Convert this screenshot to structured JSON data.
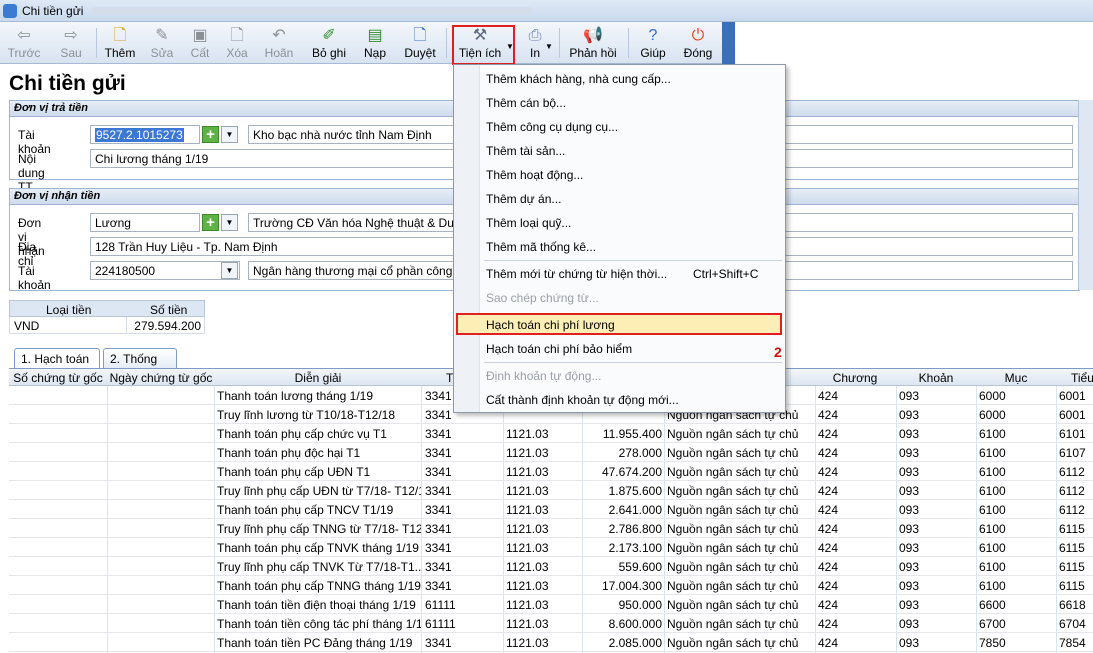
{
  "window": {
    "title": "Chi tiền gửi"
  },
  "toolbar": {
    "back": "Trước",
    "next": "Sau",
    "add": "Thêm",
    "edit": "Sửa",
    "save": "Cất",
    "delete": "Xóa",
    "undo": "Hoãn",
    "unpost": "Bỏ ghi",
    "submit": "Nạp",
    "approve": "Duyệt",
    "utilities": "Tiện ích",
    "print": "In",
    "feedback": "Phản hồi",
    "help": "Giúp",
    "close": "Đóng"
  },
  "annotations": {
    "step1": "1",
    "step2": "2"
  },
  "page": {
    "title": "Chi tiền gửi"
  },
  "payer": {
    "header": "Đơn vị trả tiền",
    "account_label": "Tài khoản",
    "account_value": "9527.2.1015273",
    "account_name": "Kho bạc nhà nước tỉnh Nam Định",
    "content_label": "Nội dung TT",
    "content_value": "Chi lương tháng 1/19"
  },
  "payee": {
    "header": "Đơn vị nhận tiền",
    "unit_label": "Đơn vị nhận",
    "unit_value": "Lương",
    "unit_name": "Trường CĐ Văn hóa Nghệ thuật & Du lịch",
    "address_label": "Địa chỉ",
    "address_value": "128 Trần Huy Liệu - Tp. Nam Định",
    "account_label": "Tài khoản",
    "account_value": "224180500",
    "bank_name": "Ngân hàng thương mại cổ phần công thương"
  },
  "money": {
    "type_header": "Loại tiền",
    "amount_header": "Số tiền",
    "type": "VND",
    "amount": "279.594.200"
  },
  "tabs": {
    "t1": "1. Hạch toán",
    "t2": "2. Thống kê"
  },
  "grid": {
    "headers": [
      "Số chứng từ gốc",
      "Ngày chứng từ gốc",
      "Diễn giải",
      "T",
      "Chương",
      "Khoản",
      "Mục",
      "Tiểu"
    ],
    "rows": [
      {
        "desc": "Thanh toán lương tháng 1/19",
        "tk": "3341",
        "tkd": "",
        "amt": "",
        "src": "",
        "ch": "424",
        "kh": "093",
        "muc": "6000",
        "tieu": "6001"
      },
      {
        "desc": "Truy lĩnh lương từ T10/18-T12/18",
        "tk": "3341",
        "tkd": "",
        "amt": "",
        "src": "Nguồn ngân sách tự chủ",
        "ch": "424",
        "kh": "093",
        "muc": "6000",
        "tieu": "6001"
      },
      {
        "desc": "Thanh toán phụ cấp chức vụ T1",
        "tk": "3341",
        "tkd": "1121.03",
        "amt": "11.955.400",
        "src": "Nguồn ngân sách tự chủ",
        "ch": "424",
        "kh": "093",
        "muc": "6100",
        "tieu": "6101"
      },
      {
        "desc": "Thanh toán phụ độc hại T1",
        "tk": "3341",
        "tkd": "1121.03",
        "amt": "278.000",
        "src": "Nguồn ngân sách tự chủ",
        "ch": "424",
        "kh": "093",
        "muc": "6100",
        "tieu": "6107"
      },
      {
        "desc": "Thanh toán phụ cấp UĐN T1",
        "tk": "3341",
        "tkd": "1121.03",
        "amt": "47.674.200",
        "src": "Nguồn ngân sách tự chủ",
        "ch": "424",
        "kh": "093",
        "muc": "6100",
        "tieu": "6112"
      },
      {
        "desc": "Truy lĩnh phụ cấp UĐN từ T7/18- T12/18",
        "tk": "3341",
        "tkd": "1121.03",
        "amt": "1.875.600",
        "src": "Nguồn ngân sách tự chủ",
        "ch": "424",
        "kh": "093",
        "muc": "6100",
        "tieu": "6112"
      },
      {
        "desc": "Thanh toán phụ cấp TNCV T1/19",
        "tk": "3341",
        "tkd": "1121.03",
        "amt": "2.641.000",
        "src": "Nguồn ngân sách tự chủ",
        "ch": "424",
        "kh": "093",
        "muc": "6100",
        "tieu": "6112"
      },
      {
        "desc": "Truy lĩnh phụ cấp TNNG từ T7/18- T12...",
        "tk": "3341",
        "tkd": "1121.03",
        "amt": "2.786.800",
        "src": "Nguồn ngân sách tự chủ",
        "ch": "424",
        "kh": "093",
        "muc": "6100",
        "tieu": "6115"
      },
      {
        "desc": "Thanh toán phụ cấp TNVK tháng 1/19",
        "tk": "3341",
        "tkd": "1121.03",
        "amt": "2.173.100",
        "src": "Nguồn ngân sách tự chủ",
        "ch": "424",
        "kh": "093",
        "muc": "6100",
        "tieu": "6115"
      },
      {
        "desc": "Truy lĩnh  phụ cấp TNVK Từ T7/18-T1...",
        "tk": "3341",
        "tkd": "1121.03",
        "amt": "559.600",
        "src": "Nguồn ngân sách tự chủ",
        "ch": "424",
        "kh": "093",
        "muc": "6100",
        "tieu": "6115"
      },
      {
        "desc": "Thanh toán phụ cấp TNNG tháng 1/19",
        "tk": "3341",
        "tkd": "1121.03",
        "amt": "17.004.300",
        "src": "Nguồn ngân sách tự chủ",
        "ch": "424",
        "kh": "093",
        "muc": "6100",
        "tieu": "6115"
      },
      {
        "desc": "Thanh toán tiền điện thoại tháng 1/19",
        "tk": "61111",
        "tkd": "1121.03",
        "amt": "950.000",
        "src": "Nguồn ngân sách tự chủ",
        "ch": "424",
        "kh": "093",
        "muc": "6600",
        "tieu": "6618"
      },
      {
        "desc": "Thanh toán tiền công tác phí tháng 1/19",
        "tk": "61111",
        "tkd": "1121.03",
        "amt": "8.600.000",
        "src": "Nguồn ngân sách tự chủ",
        "ch": "424",
        "kh": "093",
        "muc": "6700",
        "tieu": "6704"
      },
      {
        "desc": "Thanh toán tiền  PC Đảng  tháng 1/19",
        "tk": "3341",
        "tkd": "1121.03",
        "amt": "2.085.000",
        "src": "Nguồn ngân sách tự chủ",
        "ch": "424",
        "kh": "093",
        "muc": "7850",
        "tieu": "7854"
      }
    ]
  },
  "menu": {
    "items": [
      "Thêm khách hàng, nhà cung cấp...",
      "Thêm cán bộ...",
      "Thêm công cụ dụng cụ...",
      "Thêm tài sản...",
      "Thêm hoạt động...",
      "Thêm dự án...",
      "Thêm loại quỹ...",
      "Thêm mã thống kê...",
      "Thêm mới từ chứng từ hiện thời...",
      "Sao chép chứng từ...",
      "Hạch toán chi phí lương",
      "Hạch toán chi phí bảo hiểm",
      "Định khoản tự động...",
      "Cất thành định khoản tự động mới..."
    ],
    "shortcut": "Ctrl+Shift+C"
  }
}
